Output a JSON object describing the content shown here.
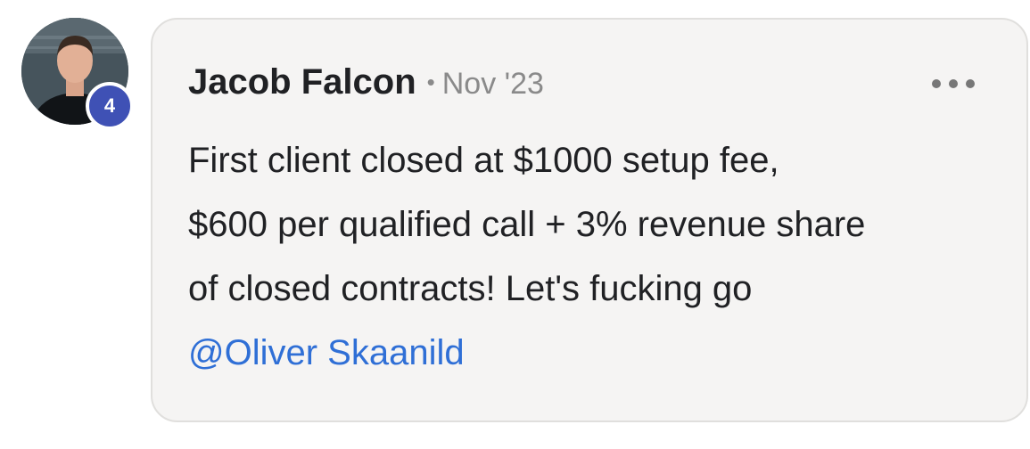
{
  "post": {
    "author": "Jacob Falcon",
    "separator": "•",
    "date": "Nov '23",
    "level": "4",
    "more_icon": "more-horizontal-icon",
    "body_lines": [
      "First client closed at $1000 setup fee,",
      "$600 per qualified call + 3% revenue share",
      "of closed contracts! Let's fucking go"
    ],
    "mention": "@Oliver Skaanild"
  },
  "colors": {
    "bubble_background": "#f5f4f3",
    "bubble_border": "#e0dfdd",
    "mention": "#2f6fd6",
    "level_badge": "#3f51b5",
    "meta_text": "#8a8a8a"
  }
}
